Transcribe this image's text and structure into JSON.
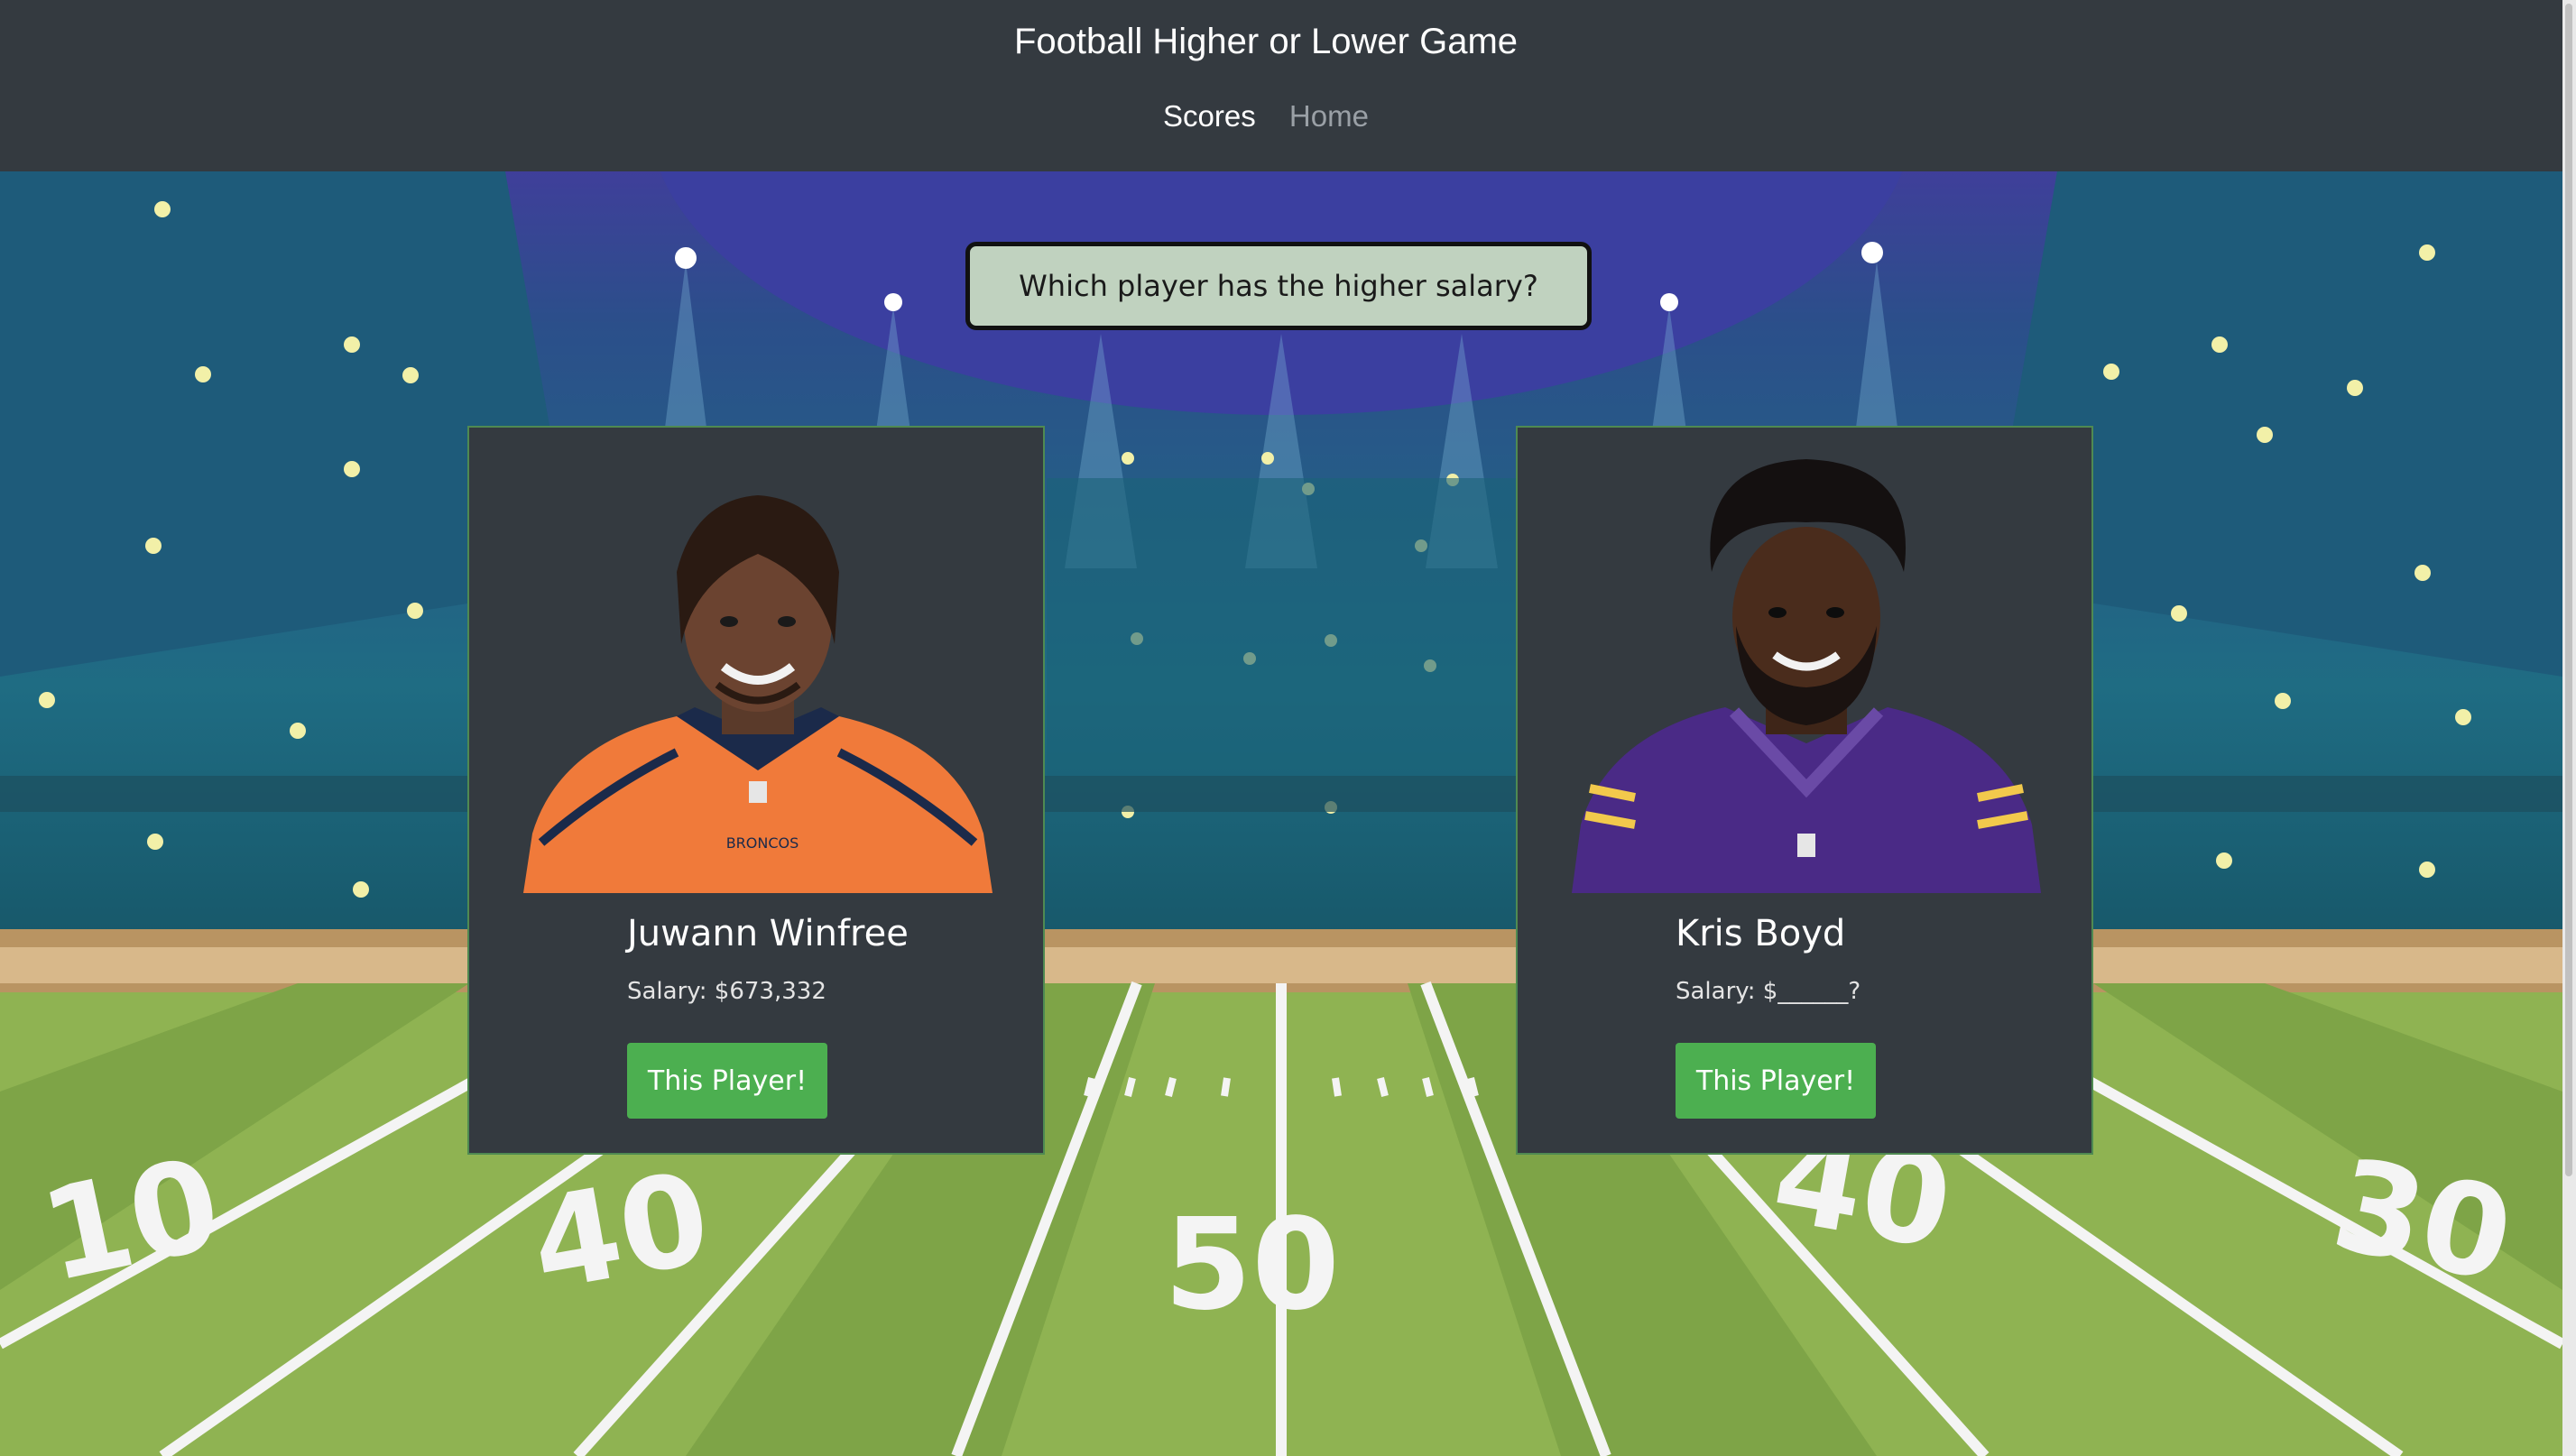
{
  "header": {
    "title": "Football Higher or Lower Game",
    "nav": [
      {
        "label": "Scores",
        "active": true
      },
      {
        "label": "Home",
        "active": false
      }
    ]
  },
  "question": "Which player has the higher salary?",
  "players": [
    {
      "name": "Juwann Winfree",
      "salary": "Salary: $673,332",
      "button": "This Player!",
      "jersey_color": "#f07a3a",
      "jersey_text": "BRONCOS"
    },
    {
      "name": "Kris Boyd",
      "salary": "Salary: $______?",
      "button": "This Player!",
      "jersey_color": "#4a2a86"
    }
  ],
  "field": {
    "yard_markers": [
      "10",
      "40",
      "50",
      "40",
      "30"
    ]
  },
  "colors": {
    "header_bg": "#343a40",
    "card_bg": "#343a40",
    "button_bg": "#4caf50",
    "question_bg": "#c0d2bf"
  }
}
